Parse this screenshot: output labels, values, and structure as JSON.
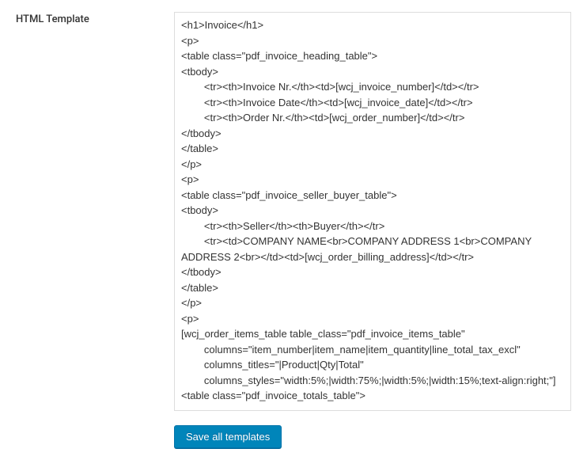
{
  "form": {
    "label": "HTML Template",
    "textarea_value": "<h1>Invoice</h1>\n<p>\n<table class=\"pdf_invoice_heading_table\">\n<tbody>\n        <tr><th>Invoice Nr.</th><td>[wcj_invoice_number]</td></tr>\n        <tr><th>Invoice Date</th><td>[wcj_invoice_date]</td></tr>\n        <tr><th>Order Nr.</th><td>[wcj_order_number]</td></tr>\n</tbody>\n</table>\n</p>\n<p>\n<table class=\"pdf_invoice_seller_buyer_table\">\n<tbody>\n        <tr><th>Seller</th><th>Buyer</th></tr>\n        <tr><td>COMPANY NAME<br>COMPANY ADDRESS 1<br>COMPANY ADDRESS 2<br></td><td>[wcj_order_billing_address]</td></tr>\n</tbody>\n</table>\n</p>\n<p>\n[wcj_order_items_table table_class=\"pdf_invoice_items_table\"\n        columns=\"item_number|item_name|item_quantity|line_total_tax_excl\"\n        columns_titles=\"|Product|Qty|Total\"\n        columns_styles=\"width:5%;|width:75%;|width:5%;|width:15%;text-align:right;\"]\n<table class=\"pdf_invoice_totals_table\">"
  },
  "actions": {
    "save_label": "Save all templates"
  }
}
